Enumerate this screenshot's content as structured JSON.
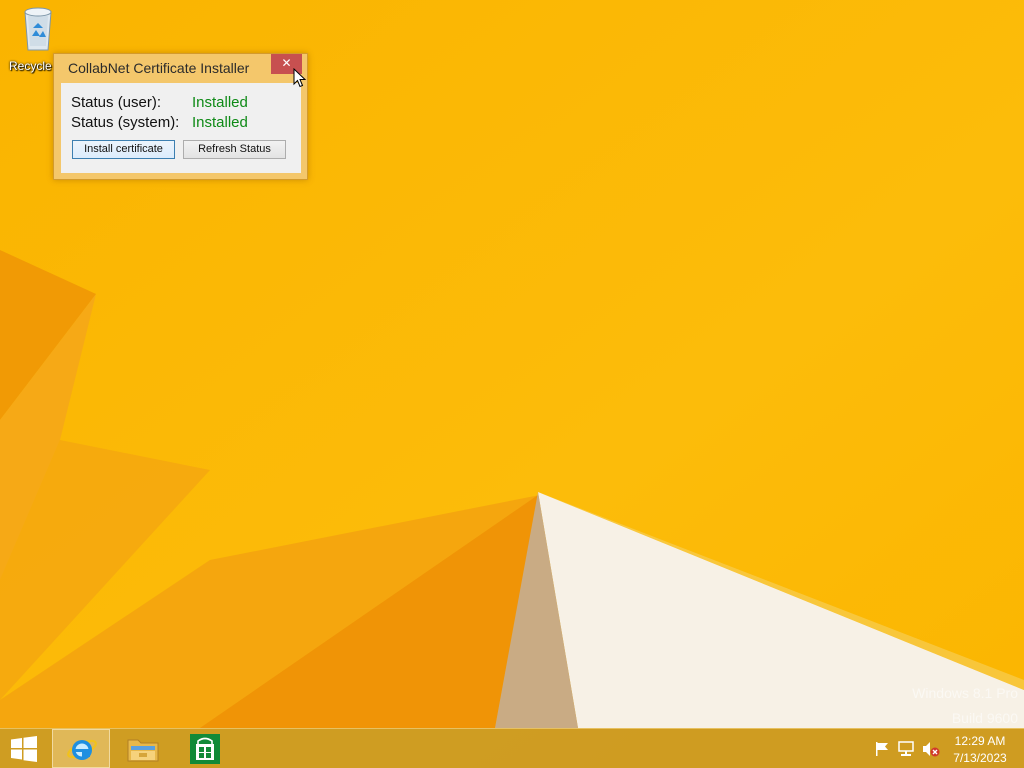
{
  "desktop": {
    "icons": [
      {
        "label": "Recycle",
        "icon": "recycle-bin-icon"
      }
    ]
  },
  "dialog": {
    "title": "CollabNet Certificate Installer",
    "close_label": "✕",
    "status_user_label": "Status (user):",
    "status_user_value": "Installed",
    "status_system_label": "Status (system):",
    "status_system_value": "Installed",
    "install_button": "Install certificate",
    "refresh_button": "Refresh Status",
    "status_color": "#0e8a16"
  },
  "watermark": {
    "line1": "Windows 8.1 Pro",
    "line2": "Build 9600"
  },
  "taskbar": {
    "buttons": [
      {
        "name": "start-button",
        "icon": "windows-logo-icon"
      },
      {
        "name": "internet-explorer",
        "icon": "internet-explorer-icon",
        "active": true
      },
      {
        "name": "file-explorer",
        "icon": "folder-icon"
      },
      {
        "name": "store",
        "icon": "store-icon"
      }
    ],
    "tray": {
      "icons": [
        "action-center-flag-icon",
        "network-icon",
        "volume-muted-icon"
      ],
      "time": "12:29 AM",
      "date": "7/13/2023"
    }
  },
  "colors": {
    "wallpaper": "#f9b700",
    "accent": "#f4c76b",
    "close_button": "#c75050"
  }
}
